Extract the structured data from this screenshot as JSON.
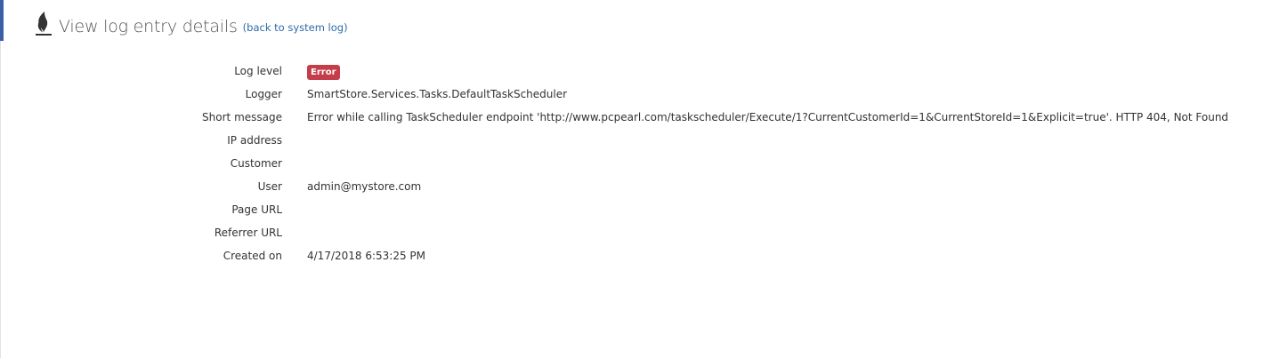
{
  "header": {
    "title": "View log entry details",
    "back_link": "(back to system log)",
    "icon": "flame-icon"
  },
  "colors": {
    "accent": "#3a5fa8",
    "error_badge": "#c43d4b",
    "link": "#2f6aa8"
  },
  "fields": {
    "log_level": {
      "label": "Log level",
      "value": "Error"
    },
    "logger": {
      "label": "Logger",
      "value": "SmartStore.Services.Tasks.DefaultTaskScheduler"
    },
    "short_message": {
      "label": "Short message",
      "value": "Error while calling TaskScheduler endpoint 'http://www.pcpearl.com/taskscheduler/Execute/1?CurrentCustomerId=1&CurrentStoreId=1&Explicit=true'. HTTP 404, Not Found"
    },
    "ip_address": {
      "label": "IP address",
      "value": ""
    },
    "customer": {
      "label": "Customer",
      "value": ""
    },
    "user": {
      "label": "User",
      "value": "admin@mystore.com"
    },
    "page_url": {
      "label": "Page URL",
      "value": ""
    },
    "referrer_url": {
      "label": "Referrer URL",
      "value": ""
    },
    "created_on": {
      "label": "Created on",
      "value": "4/17/2018 6:53:25 PM"
    }
  }
}
